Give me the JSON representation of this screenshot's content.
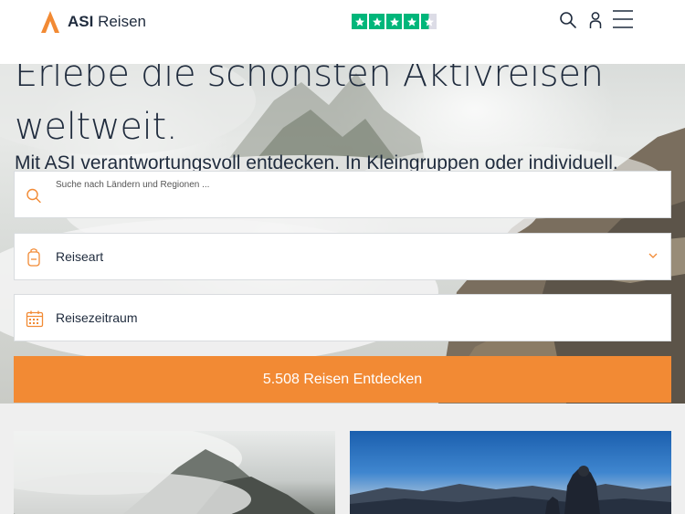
{
  "header": {
    "logo_text_bold": "ASI",
    "logo_text": "Reisen",
    "trustpilot_rating": 4.5,
    "trust_color": "#00b67a"
  },
  "hero": {
    "title": "Erlebe die schönsten Aktivreisen weltweit.",
    "subtitle": "Mit ASI verantwortungsvoll entdecken. In Kleingruppen oder individuell."
  },
  "form": {
    "search_placeholder": "Suche nach Ländern und Regionen ...",
    "type_label": "Reiseart",
    "period_label": "Reisezeitraum",
    "cta_label": "5.508 Reisen Entdecken"
  },
  "colors": {
    "accent": "#f28a34",
    "text": "#1f2b3d"
  }
}
